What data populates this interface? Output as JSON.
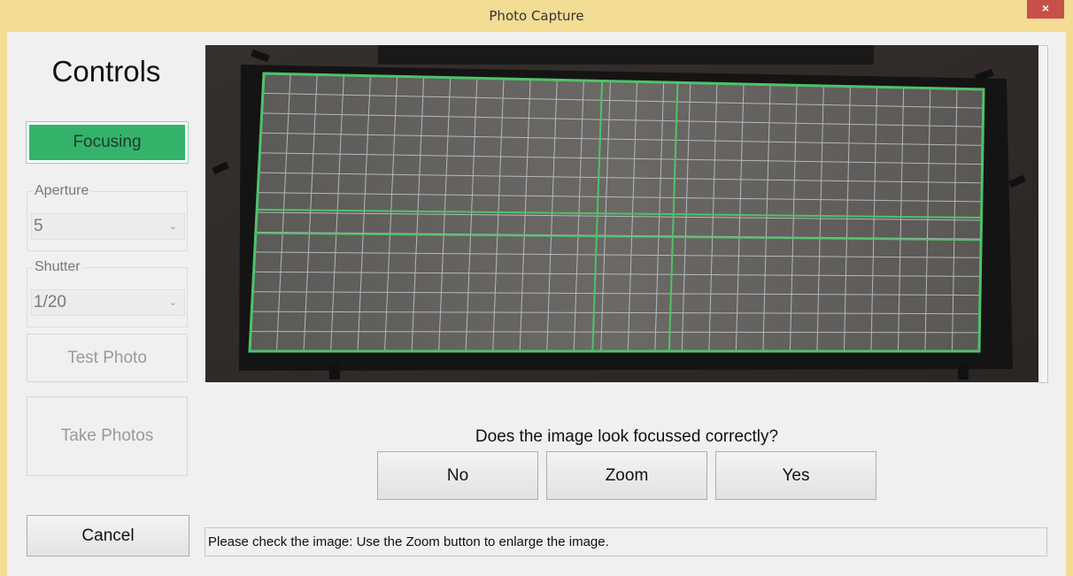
{
  "window": {
    "title": "Photo Capture",
    "close_label": "×"
  },
  "sidebar": {
    "heading": "Controls",
    "focus_button": "Focusing",
    "aperture": {
      "label": "Aperture",
      "value": "5"
    },
    "shutter": {
      "label": "Shutter",
      "value": "1/20"
    },
    "test_photo_button": "Test Photo",
    "take_photos_button": "Take Photos",
    "cancel_button": "Cancel"
  },
  "main": {
    "question": "Does the image look focussed correctly?",
    "buttons": {
      "no": "No",
      "zoom": "Zoom",
      "yes": "Yes"
    },
    "status": "Please check the image: Use the Zoom button to enlarge the image."
  },
  "colors": {
    "titlebar": "#f3dc93",
    "focus_accent": "#34b36a",
    "close": "#c7504b",
    "grid_green": "#4fc26a"
  },
  "icons": {
    "dropdown": "chevron-down-icon",
    "close": "close-icon"
  }
}
